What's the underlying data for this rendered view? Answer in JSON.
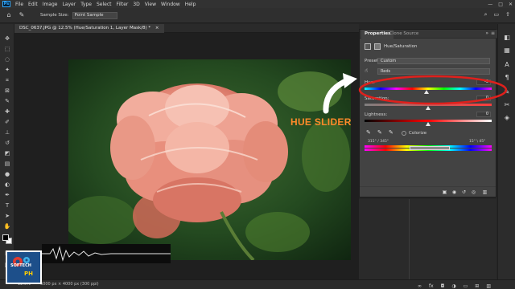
{
  "app": {
    "logo": "Ps",
    "menu": [
      "File",
      "Edit",
      "Image",
      "Layer",
      "Type",
      "Select",
      "Filter",
      "3D",
      "View",
      "Window",
      "Help"
    ],
    "window_controls": [
      "—",
      "□",
      "✕"
    ]
  },
  "options_bar": {
    "tool_icon": "eyedropper-icon",
    "sample_size_label": "Sample Size:",
    "sample_size_value": "Point Sample"
  },
  "document": {
    "tab_title": "DSC_0637.JPG @ 12.5% (Hue/Saturation 1, Layer Mask/8) *",
    "tab_close": "×"
  },
  "properties": {
    "tab_active": "Properties",
    "tab_inactive": "Clone Source",
    "collapse": "»",
    "menu": "≡",
    "adjustment_name": "Hue/Saturation",
    "preset_label": "Preset:",
    "preset_value": "Custom",
    "channel_value": "Reds",
    "hue_label": "Hue:",
    "hue_value": "-3",
    "saturation_label": "Saturation:",
    "saturation_value": "0",
    "lightness_label": "Lightness:",
    "lightness_value": "0",
    "colorize_label": "Colorize",
    "range_left": "315° / 345°",
    "range_right": "15° \\ 45°",
    "hue_level": 0.49,
    "saturation_level": 0.5,
    "lightness_level": 0.5
  },
  "annotation": {
    "callout": "HUE SLIDER",
    "accent": "#ff8a2a",
    "ellipse_color": "#e0201c"
  },
  "status": {
    "zoom": "12.5%",
    "doc_size": "6000 px × 4000 px (300 ppi)"
  },
  "watermark": {
    "brand": "SOFTECH",
    "sub": "PH"
  }
}
